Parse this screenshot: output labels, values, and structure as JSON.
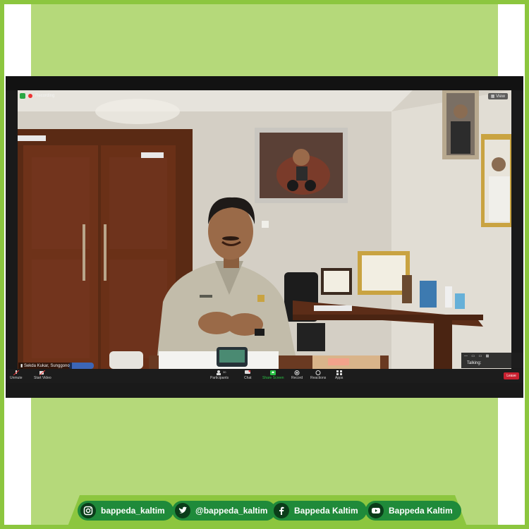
{
  "zoom": {
    "recording_label": "Recording",
    "view_label": "View",
    "participant_name": "Sekda Kukar, Sunggono",
    "talking_label": "Talking:",
    "toolbar": {
      "unmute": "Unmute",
      "start_video": "Start Video",
      "participants": "Participants",
      "participants_count": "30",
      "chat": "Chat",
      "share_screen": "Share Screen",
      "record": "Record",
      "reactions": "Reactions",
      "apps": "Apps",
      "leave": "Leave"
    }
  },
  "footer": {
    "instagram": "bappeda_kaltim",
    "twitter": "@bappeda_kaltim",
    "facebook": "Bappeda Kaltim",
    "youtube": "Bappeda Kaltim"
  },
  "colors": {
    "frame_green": "#8cc63f",
    "panel_green": "#b5d97a",
    "pill_green": "#1f8a3a",
    "zoom_dark": "#1a1a1a",
    "leave_red": "#c8202f",
    "share_green": "#29c244"
  }
}
